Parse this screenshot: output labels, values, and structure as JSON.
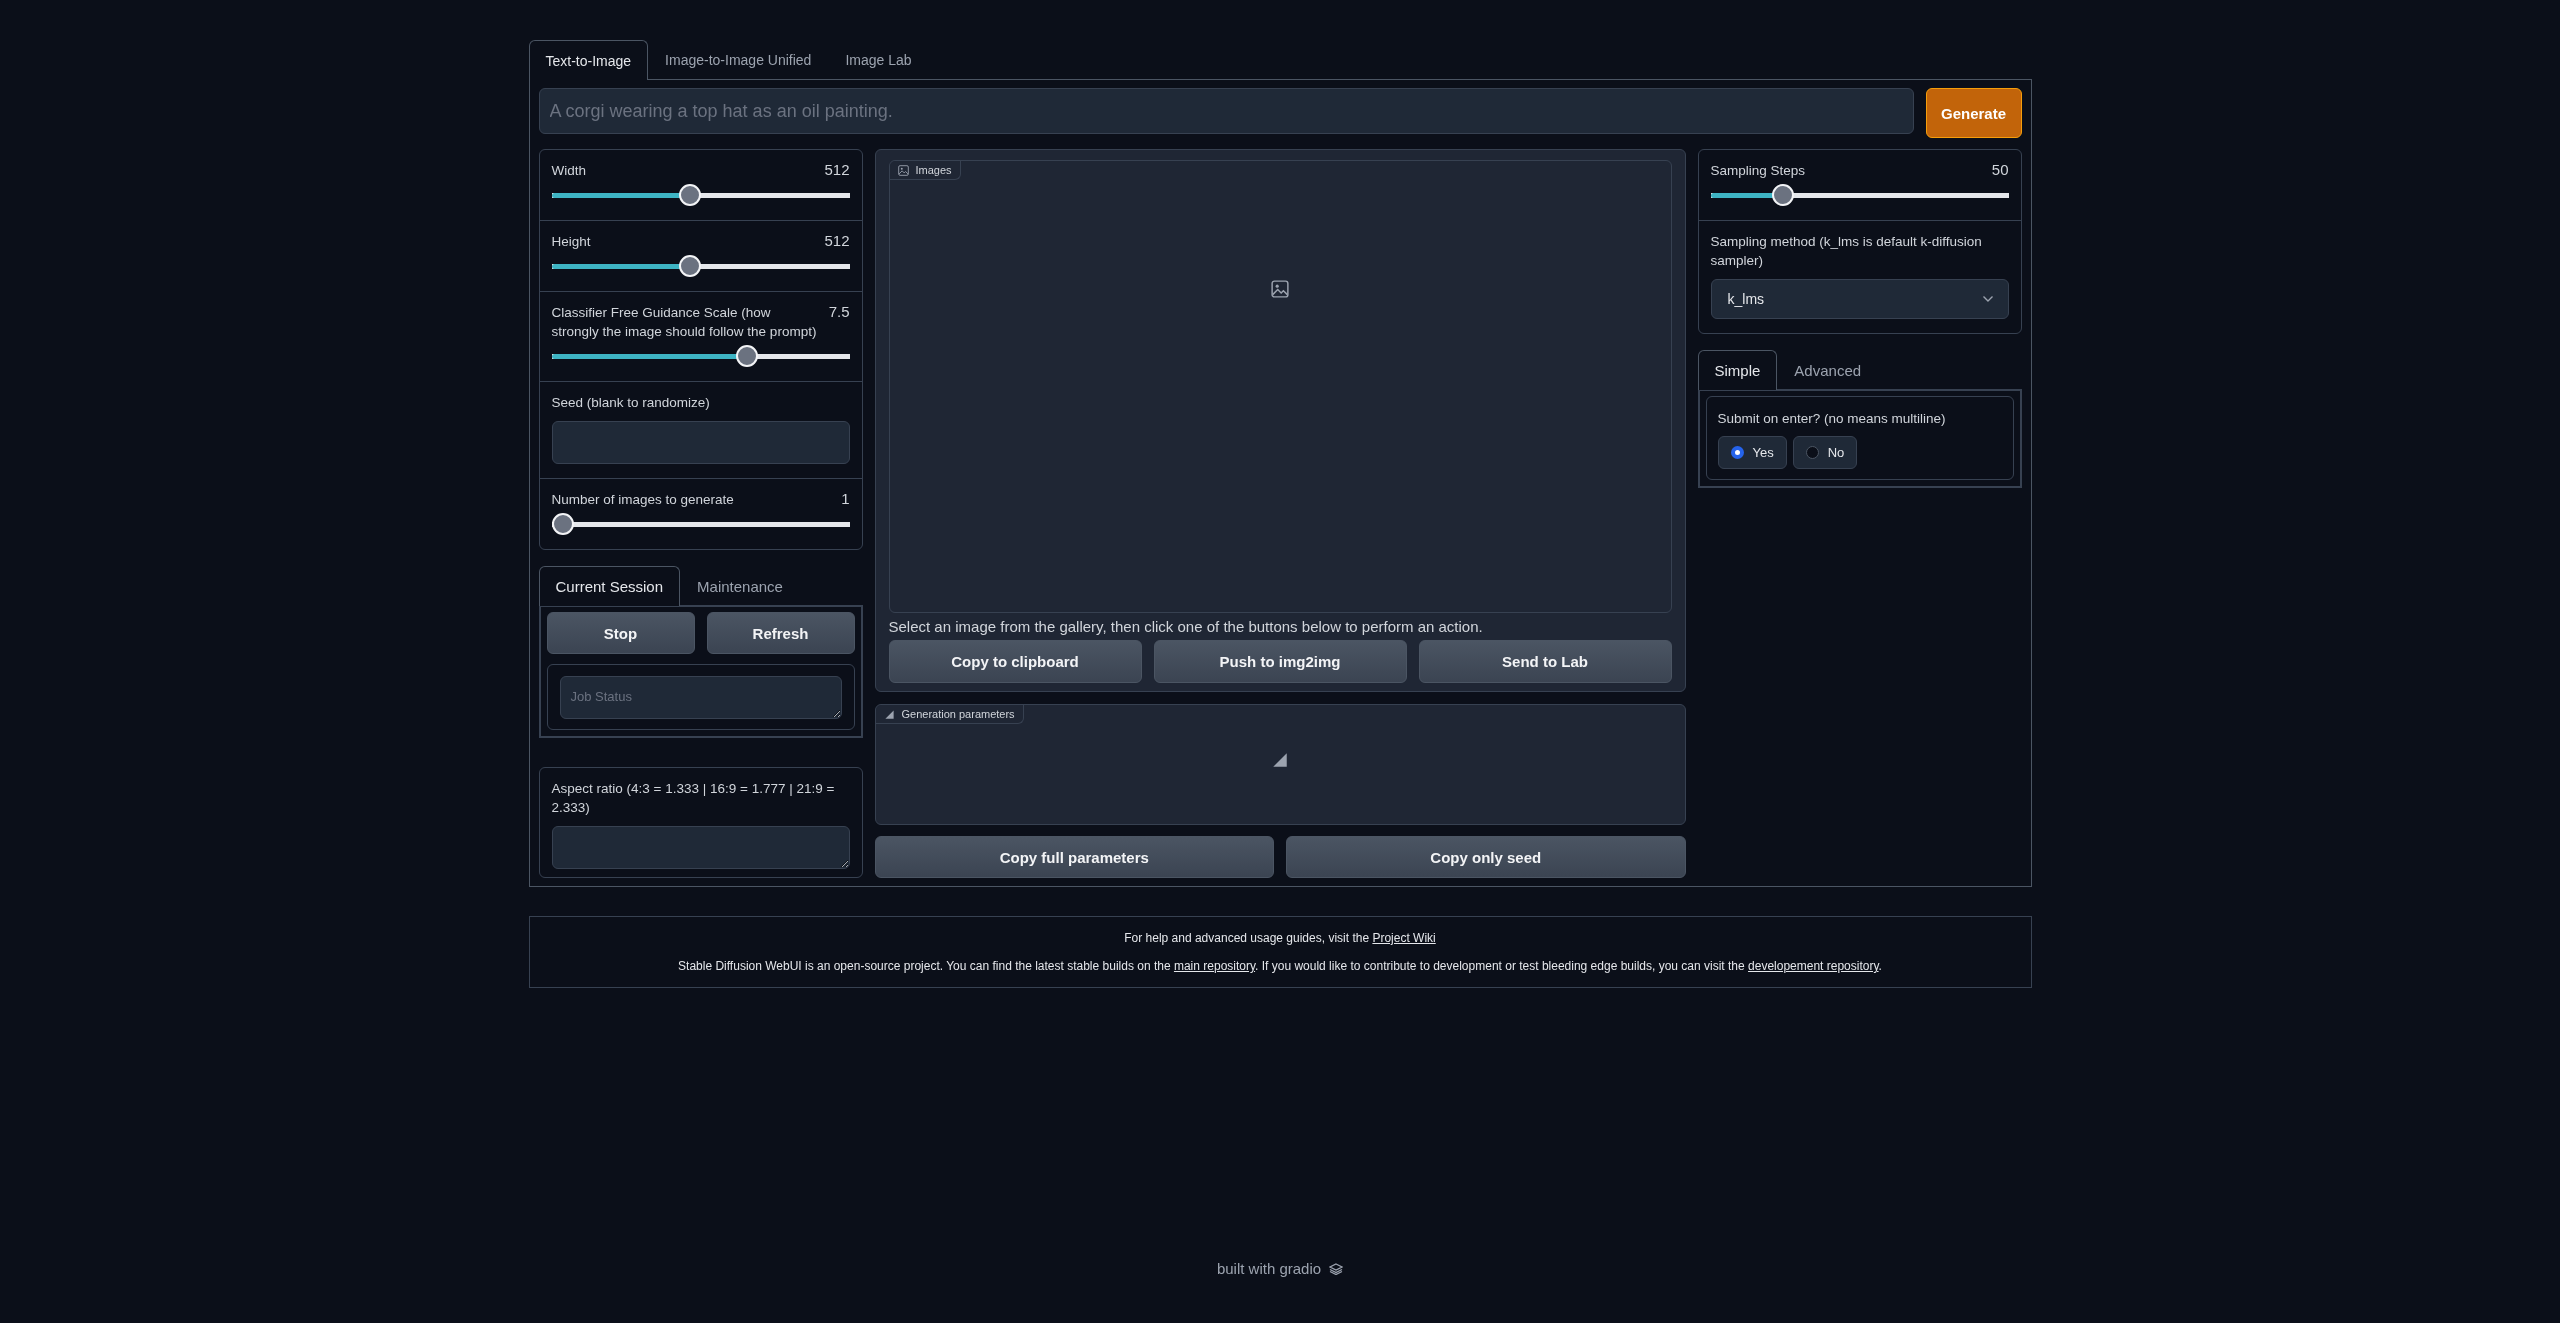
{
  "tabs": [
    {
      "label": "Text-to-Image",
      "selected": true
    },
    {
      "label": "Image-to-Image Unified",
      "selected": false
    },
    {
      "label": "Image Lab",
      "selected": false
    }
  ],
  "prompt": {
    "placeholder": "A corgi wearing a top hat as an oil painting."
  },
  "generate_button": "Generate",
  "left_settings": [
    {
      "kind": "slider",
      "label": "Width",
      "value": "512",
      "level": 0.46
    },
    {
      "kind": "slider",
      "label": "Height",
      "value": "512",
      "level": 0.46
    },
    {
      "kind": "slider",
      "label": "Classifier Free Guidance Scale (how strongly the image should follow the prompt)",
      "value": "7.5",
      "level": 0.665
    },
    {
      "kind": "textbox",
      "label": "Seed (blank to randomize)"
    },
    {
      "kind": "slider",
      "label": "Number of images to generate",
      "value": "1",
      "level": 0
    }
  ],
  "session_tabs": [
    {
      "label": "Current Session",
      "selected": true
    },
    {
      "label": "Maintenance",
      "selected": false
    }
  ],
  "session_buttons": [
    "Stop",
    "Refresh"
  ],
  "job_status": {
    "placeholder": "Job Status"
  },
  "aspect_ratio": {
    "label": "Aspect ratio (4:3 = 1.333 | 16:9 = 1.777 | 21:9 = 2.333)"
  },
  "gallery": {
    "label": "Images",
    "hint": "Select an image from the gallery, then click one of the buttons below to perform an action.",
    "buttons": [
      "Copy to clipboard",
      "Push to img2img",
      "Send to Lab"
    ]
  },
  "generation_parameters": {
    "label": "Generation parameters"
  },
  "parameter_buttons": [
    "Copy full parameters",
    "Copy only seed"
  ],
  "right_settings": [
    {
      "kind": "slider",
      "label": "Sampling Steps",
      "value": "50",
      "level": 0.22
    },
    {
      "kind": "dropdown",
      "label": "Sampling method (k_lms is default k-diffusion sampler)",
      "value": "k_lms"
    }
  ],
  "option_tabs": [
    {
      "label": "Simple",
      "selected": true
    },
    {
      "label": "Advanced",
      "selected": false
    }
  ],
  "submit_on_enter": {
    "label": "Submit on enter? (no means multiline)",
    "options": [
      {
        "label": "Yes",
        "selected": true
      },
      {
        "label": "No",
        "selected": false
      }
    ]
  },
  "footer": {
    "lines": [
      [
        {
          "kind": "text",
          "text": "For help and advanced usage guides, visit the "
        },
        {
          "kind": "link",
          "text": "Project Wiki"
        }
      ],
      [
        {
          "kind": "text",
          "text": "Stable Diffusion WebUI is an open-source project. You can find the latest stable builds on the "
        },
        {
          "kind": "link",
          "text": "main repository"
        },
        {
          "kind": "text",
          "text": ". If you would like to contribute to development or test bleeding edge builds, you can visit the "
        },
        {
          "kind": "link",
          "text": "developement repository"
        },
        {
          "kind": "text",
          "text": "."
        }
      ]
    ]
  },
  "built_with": "built with gradio"
}
